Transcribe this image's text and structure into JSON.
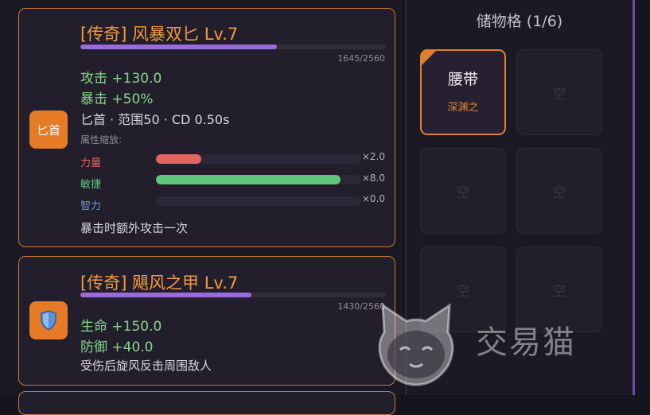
{
  "equipment": [
    {
      "icon_label": "匕首",
      "icon_color": "#e57b25",
      "title": "[传奇] 风暴双匕 Lv.7",
      "xp_text": "1645/2560",
      "xp_progress": 0.643,
      "stats": [
        "攻击 +130.0",
        "暴击 +50%"
      ],
      "meta": "匕首 · 范围50 · CD 0.50s",
      "scaling_header": "属性缩放:",
      "attributes": [
        {
          "name": "力量",
          "color": "#e0665f",
          "fill": 0.22,
          "multiplier": "×2.0"
        },
        {
          "name": "敏捷",
          "color": "#5ec77a",
          "fill": 0.9,
          "multiplier": "×8.0"
        },
        {
          "name": "智力",
          "color": "#6f93e0",
          "fill": 0.0,
          "multiplier": "×0.0"
        }
      ],
      "description": "暴击时额外攻击一次"
    },
    {
      "icon": "shield-icon",
      "icon_color": "#e57b25",
      "title": "[传奇] 飓风之甲 Lv.7",
      "xp_text": "1430/2560",
      "xp_progress": 0.559,
      "stats": [
        "生命 +150.0",
        "防御 +40.0"
      ],
      "description": "受伤后旋风反击周围敌人"
    }
  ],
  "storage": {
    "title": "储物格 (1/6)",
    "slots": [
      {
        "filled": true,
        "name": "腰带",
        "sub": "深渊之"
      },
      {
        "filled": false,
        "label": "空"
      },
      {
        "filled": false,
        "label": "空"
      },
      {
        "filled": false,
        "label": "空"
      },
      {
        "filled": false,
        "label": "空"
      },
      {
        "filled": false,
        "label": "空"
      }
    ]
  },
  "watermark": {
    "text": "交易猫",
    "icon": "cat-logo-icon"
  },
  "colors": {
    "accent": "#e07f2e",
    "xp_bar": "#9a6bdc",
    "stat_green": "#83d889",
    "title_orange": "#f29a3c"
  }
}
